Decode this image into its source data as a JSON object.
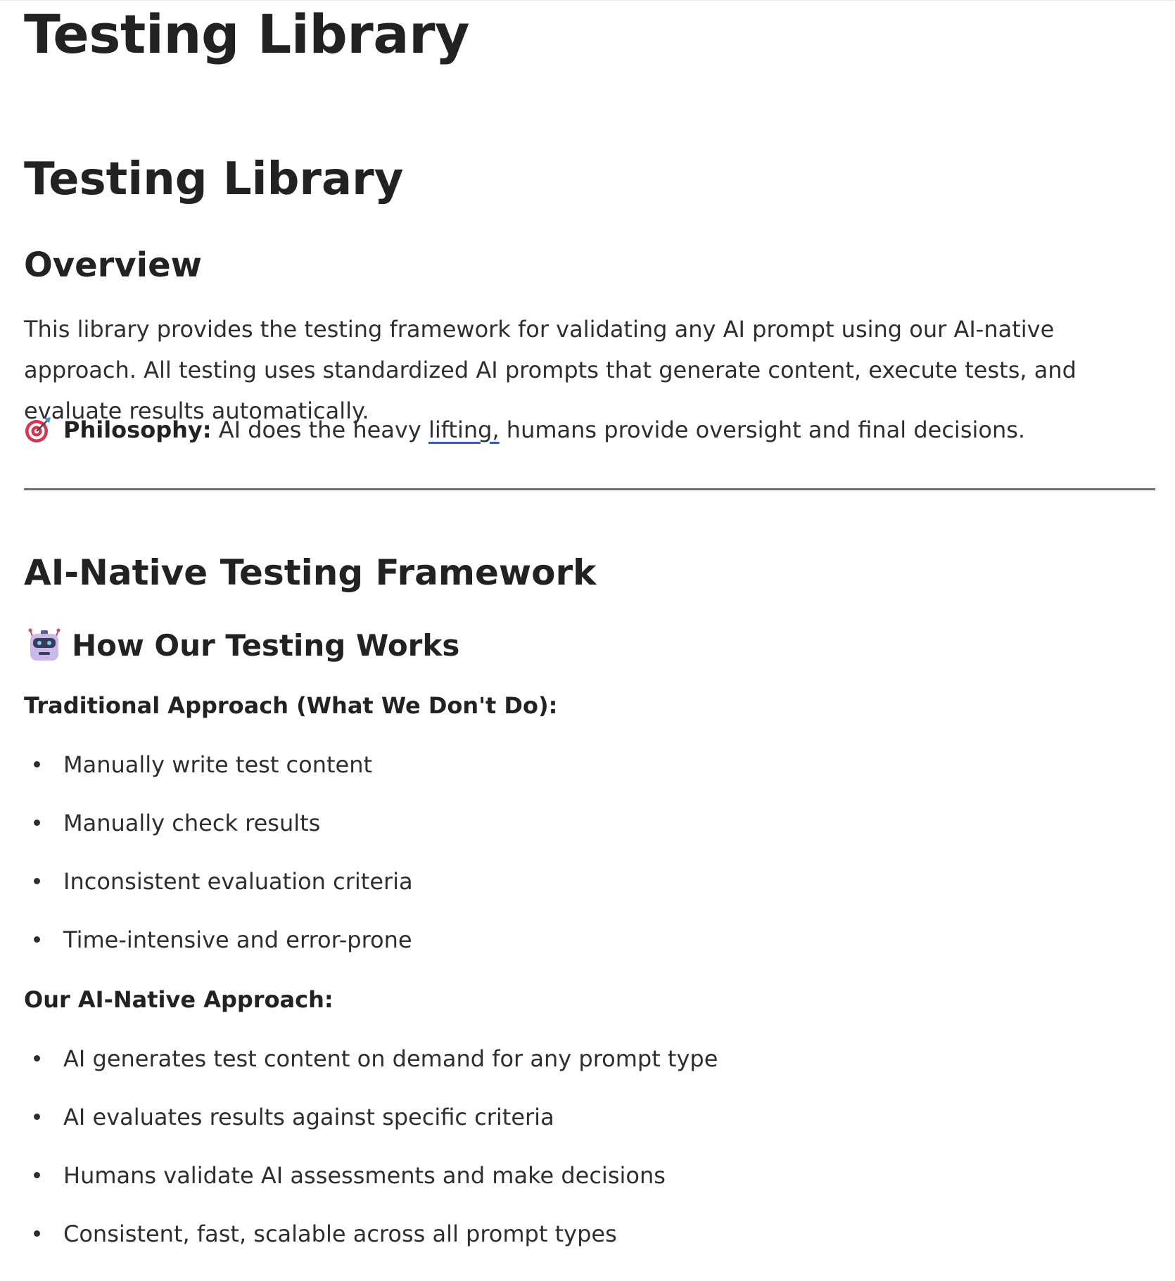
{
  "page_title": "Testing Library",
  "doc_title": "Testing Library",
  "overview": {
    "heading": "Overview",
    "paragraph": "This library provides the testing framework for validating any AI prompt using our AI-native approach. All testing uses standardized AI prompts that generate content, execute tests, and evaluate results automatically.",
    "philosophy_icon": "direct-hit-target-icon",
    "philosophy_label": "Philosophy:",
    "philosophy_before_link": "AI does the heavy ",
    "philosophy_link": "lifting,",
    "philosophy_after_link": " humans provide oversight and final decisions."
  },
  "framework": {
    "heading": "AI-Native Testing Framework",
    "how_icon": "robot-icon",
    "how_heading": "How Our Testing Works",
    "traditional_label": "Traditional Approach (What We Don't Do):",
    "traditional_items": [
      "Manually write test content",
      "Manually check results",
      "Inconsistent evaluation criteria",
      "Time-intensive and error-prone"
    ],
    "ai_label": "Our AI-Native Approach:",
    "ai_items": [
      "AI generates test content on demand for any prompt type",
      "AI evaluates results against specific criteria",
      "Humans validate AI assessments and make decisions",
      "Consistent, fast, scalable across all prompt types"
    ]
  },
  "colors": {
    "text": "#2e2e2e",
    "heading": "#222222",
    "rule": "#6f6f6f",
    "link_underline": "#3a57c4"
  }
}
